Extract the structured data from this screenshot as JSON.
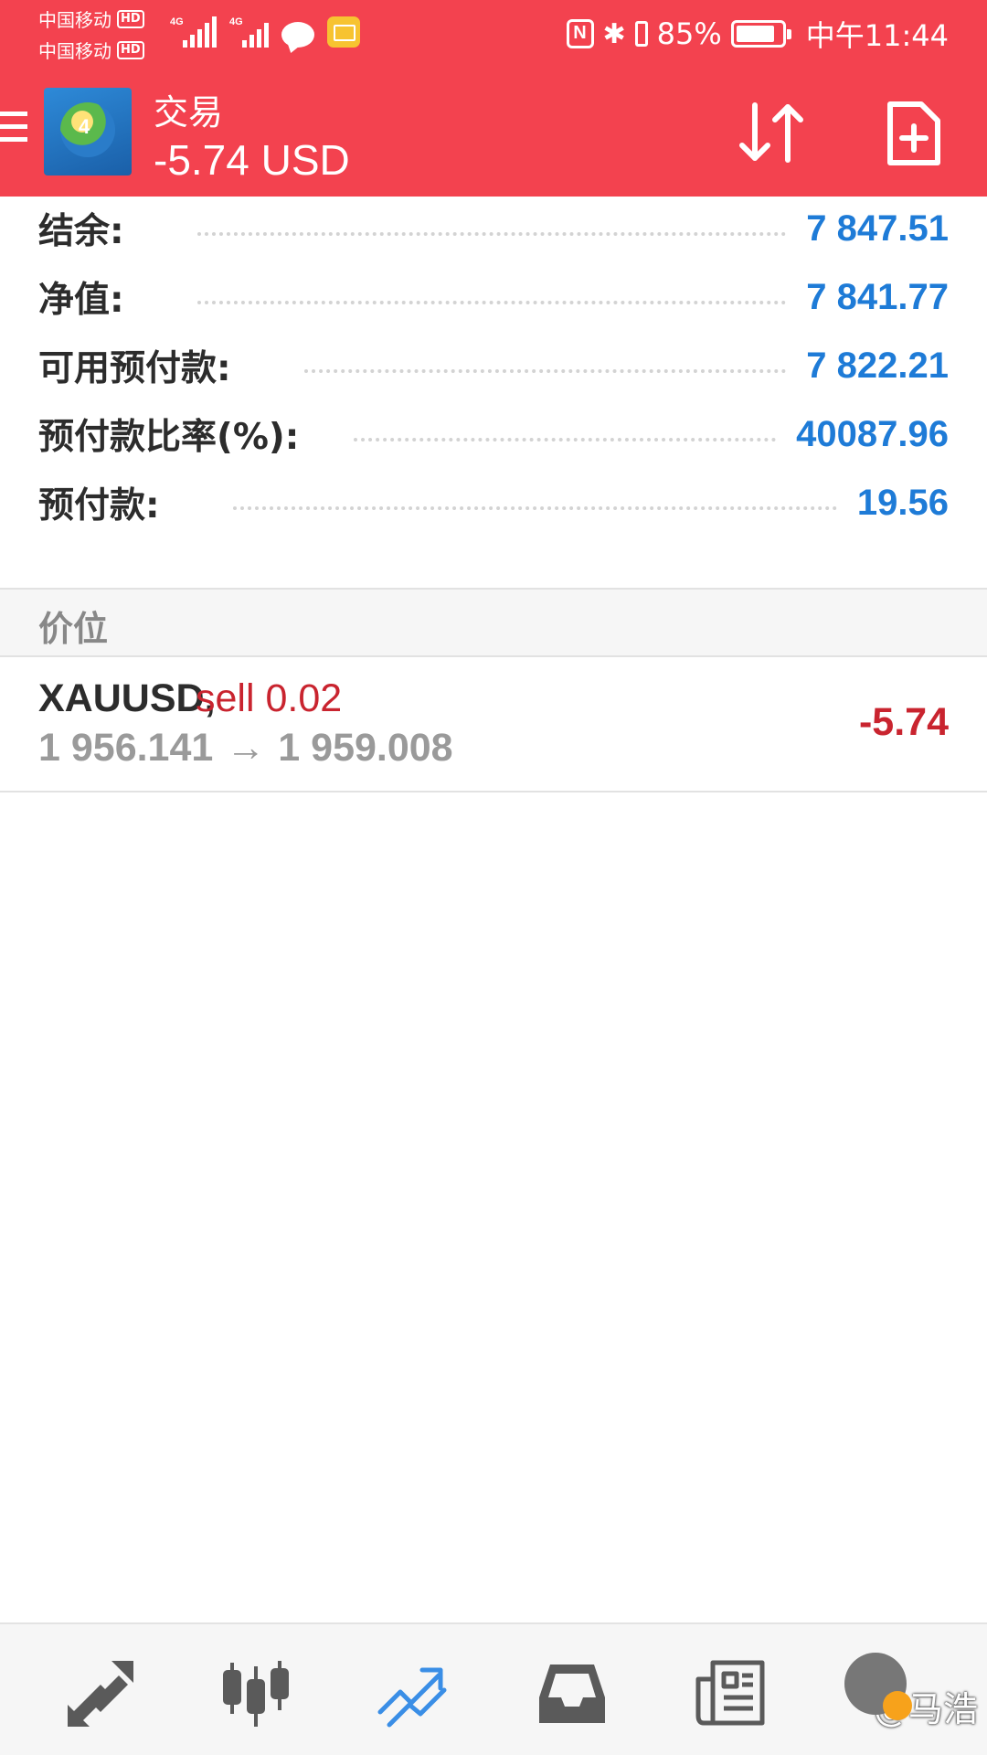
{
  "status_bar": {
    "carrier_1": "中国移动",
    "carrier_2": "中国移动",
    "hd_badge": "HD",
    "network_1": "4G",
    "network_2": "4G",
    "nfc": "N",
    "battery_percent": "85%",
    "time": "中午11:44",
    "icons": [
      "signal-icon",
      "chat-bubble-icon",
      "mail-icon",
      "nfc-icon",
      "bluetooth-icon",
      "battery-icon"
    ]
  },
  "header": {
    "title": "交易",
    "subtitle": "-5.74 USD",
    "logo_number": "4",
    "icons": [
      "menu-icon",
      "app-logo",
      "sort-icon",
      "new-order-icon"
    ]
  },
  "summary": [
    {
      "label": "结余:",
      "value": "7 847.51"
    },
    {
      "label": "净值:",
      "value": "7 841.77"
    },
    {
      "label": "可用预付款:",
      "value": "7 822.21"
    },
    {
      "label": "预付款比率(%):",
      "value": "40087.96"
    },
    {
      "label": "预付款:",
      "value": "19.56"
    }
  ],
  "positions_section": {
    "title": "价位"
  },
  "positions": [
    {
      "symbol": "XAUUSD,",
      "side": "sell 0.02",
      "open_price": "1 956.141",
      "arrow": "→",
      "current_price": "1 959.008",
      "profit": "-5.74"
    }
  ],
  "bottom_nav": {
    "items": [
      "quotes-icon",
      "chart-icon",
      "trade-icon",
      "history-icon",
      "news-icon",
      "messages-icon"
    ],
    "active": "trade-icon",
    "active_color": "#3a8ee6",
    "inactive_color": "#5a5a5a"
  },
  "watermark": "@马浩",
  "colors": {
    "header_bg": "#f3424f",
    "value_blue": "#1e7bd7",
    "loss_red": "#c9242f"
  }
}
